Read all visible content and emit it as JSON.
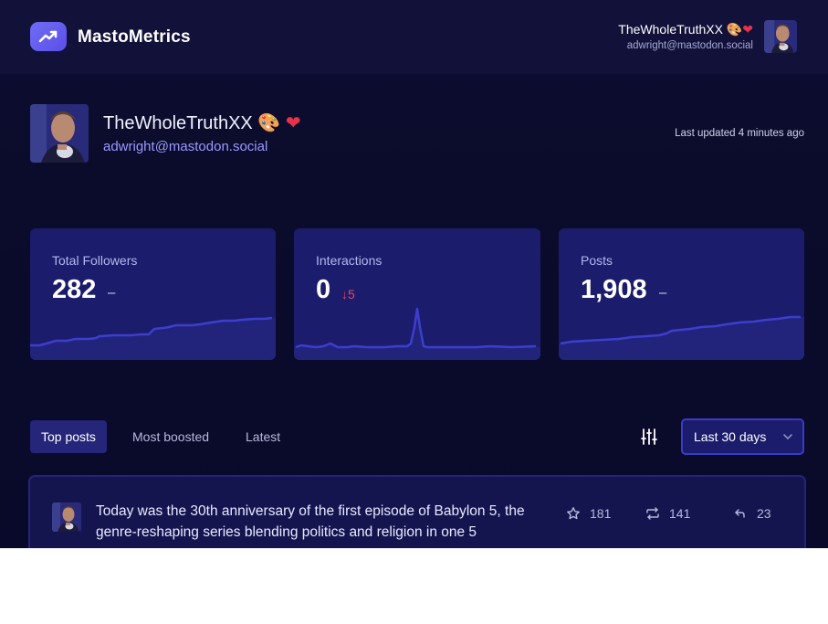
{
  "app": {
    "name": "MastoMetrics",
    "logo_icon": "trend-up-icon",
    "accent": "#6f6cf6"
  },
  "header_user": {
    "display_name": "TheWholeTruthXX",
    "emoji": [
      "🎨",
      "❤"
    ],
    "handle": "adwright@mastodon.social"
  },
  "profile": {
    "display_name": "TheWholeTruthXX",
    "emoji": [
      "🎨",
      "❤"
    ],
    "handle": "adwright@mastodon.social",
    "last_updated": "Last updated 4 minutes ago"
  },
  "stats": [
    {
      "label": "Total Followers",
      "value": "282",
      "trend": "–"
    },
    {
      "label": "Interactions",
      "value": "0",
      "trend": "5",
      "trend_direction": "down"
    },
    {
      "label": "Posts",
      "value": "1,908",
      "trend": "–"
    }
  ],
  "tabs": [
    {
      "label": "Top posts",
      "active": true
    },
    {
      "label": "Most boosted",
      "active": false
    },
    {
      "label": "Latest",
      "active": false
    }
  ],
  "filter": {
    "icon": "sliders-icon",
    "range_label": "Last 30 days"
  },
  "posts": [
    {
      "text": "Today was the 30th anniversary of the first episode of Babylon 5, the genre-reshaping series blending politics and religion in one 5",
      "favourites": "181",
      "boosts": "141",
      "replies": "23"
    }
  ],
  "colors": {
    "card_bg": "#1b1c6b",
    "spark_line": "#3c3fce",
    "down": "#e8475b"
  }
}
